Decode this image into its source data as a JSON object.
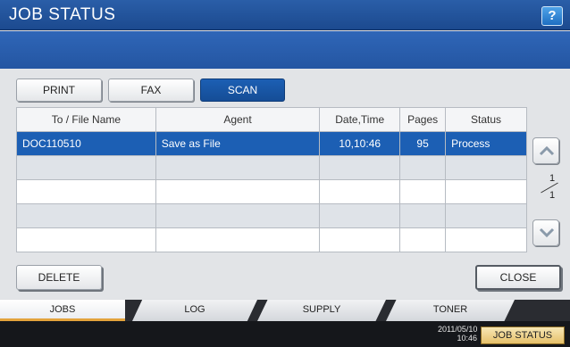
{
  "window": {
    "title": "JOB STATUS",
    "help_label": "?"
  },
  "category_tabs": [
    {
      "label": "PRINT",
      "active": false
    },
    {
      "label": "FAX",
      "active": false
    },
    {
      "label": "SCAN",
      "active": true
    }
  ],
  "table": {
    "columns": [
      "To / File Name",
      "Agent",
      "Date,Time",
      "Pages",
      "Status"
    ],
    "rows": [
      {
        "file": "DOC110510",
        "agent": "Save as File",
        "datetime": "10,10:46",
        "pages": "95",
        "status": "Process",
        "selected": true
      },
      {
        "file": "",
        "agent": "",
        "datetime": "",
        "pages": "",
        "status": "",
        "selected": false
      },
      {
        "file": "",
        "agent": "",
        "datetime": "",
        "pages": "",
        "status": "",
        "selected": false
      },
      {
        "file": "",
        "agent": "",
        "datetime": "",
        "pages": "",
        "status": "",
        "selected": false
      },
      {
        "file": "",
        "agent": "",
        "datetime": "",
        "pages": "",
        "status": "",
        "selected": false
      }
    ]
  },
  "pager": {
    "current": "1",
    "total": "1",
    "up_icon": "chevron-up-icon",
    "down_icon": "chevron-down-icon"
  },
  "actions": {
    "delete_label": "DELETE",
    "close_label": "CLOSE"
  },
  "bottom_tabs": [
    {
      "label": "JOBS",
      "active": true
    },
    {
      "label": "LOG",
      "active": false
    },
    {
      "label": "SUPPLY",
      "active": false
    },
    {
      "label": "TONER",
      "active": false
    }
  ],
  "status_bar": {
    "date": "2011/05/10",
    "time": "10:46",
    "job_status_label": "JOB STATUS"
  },
  "colors": {
    "accent": "#1c5fb4",
    "title_bar": "#1c4a8f",
    "active_tab_underline": "#e3a33c"
  }
}
